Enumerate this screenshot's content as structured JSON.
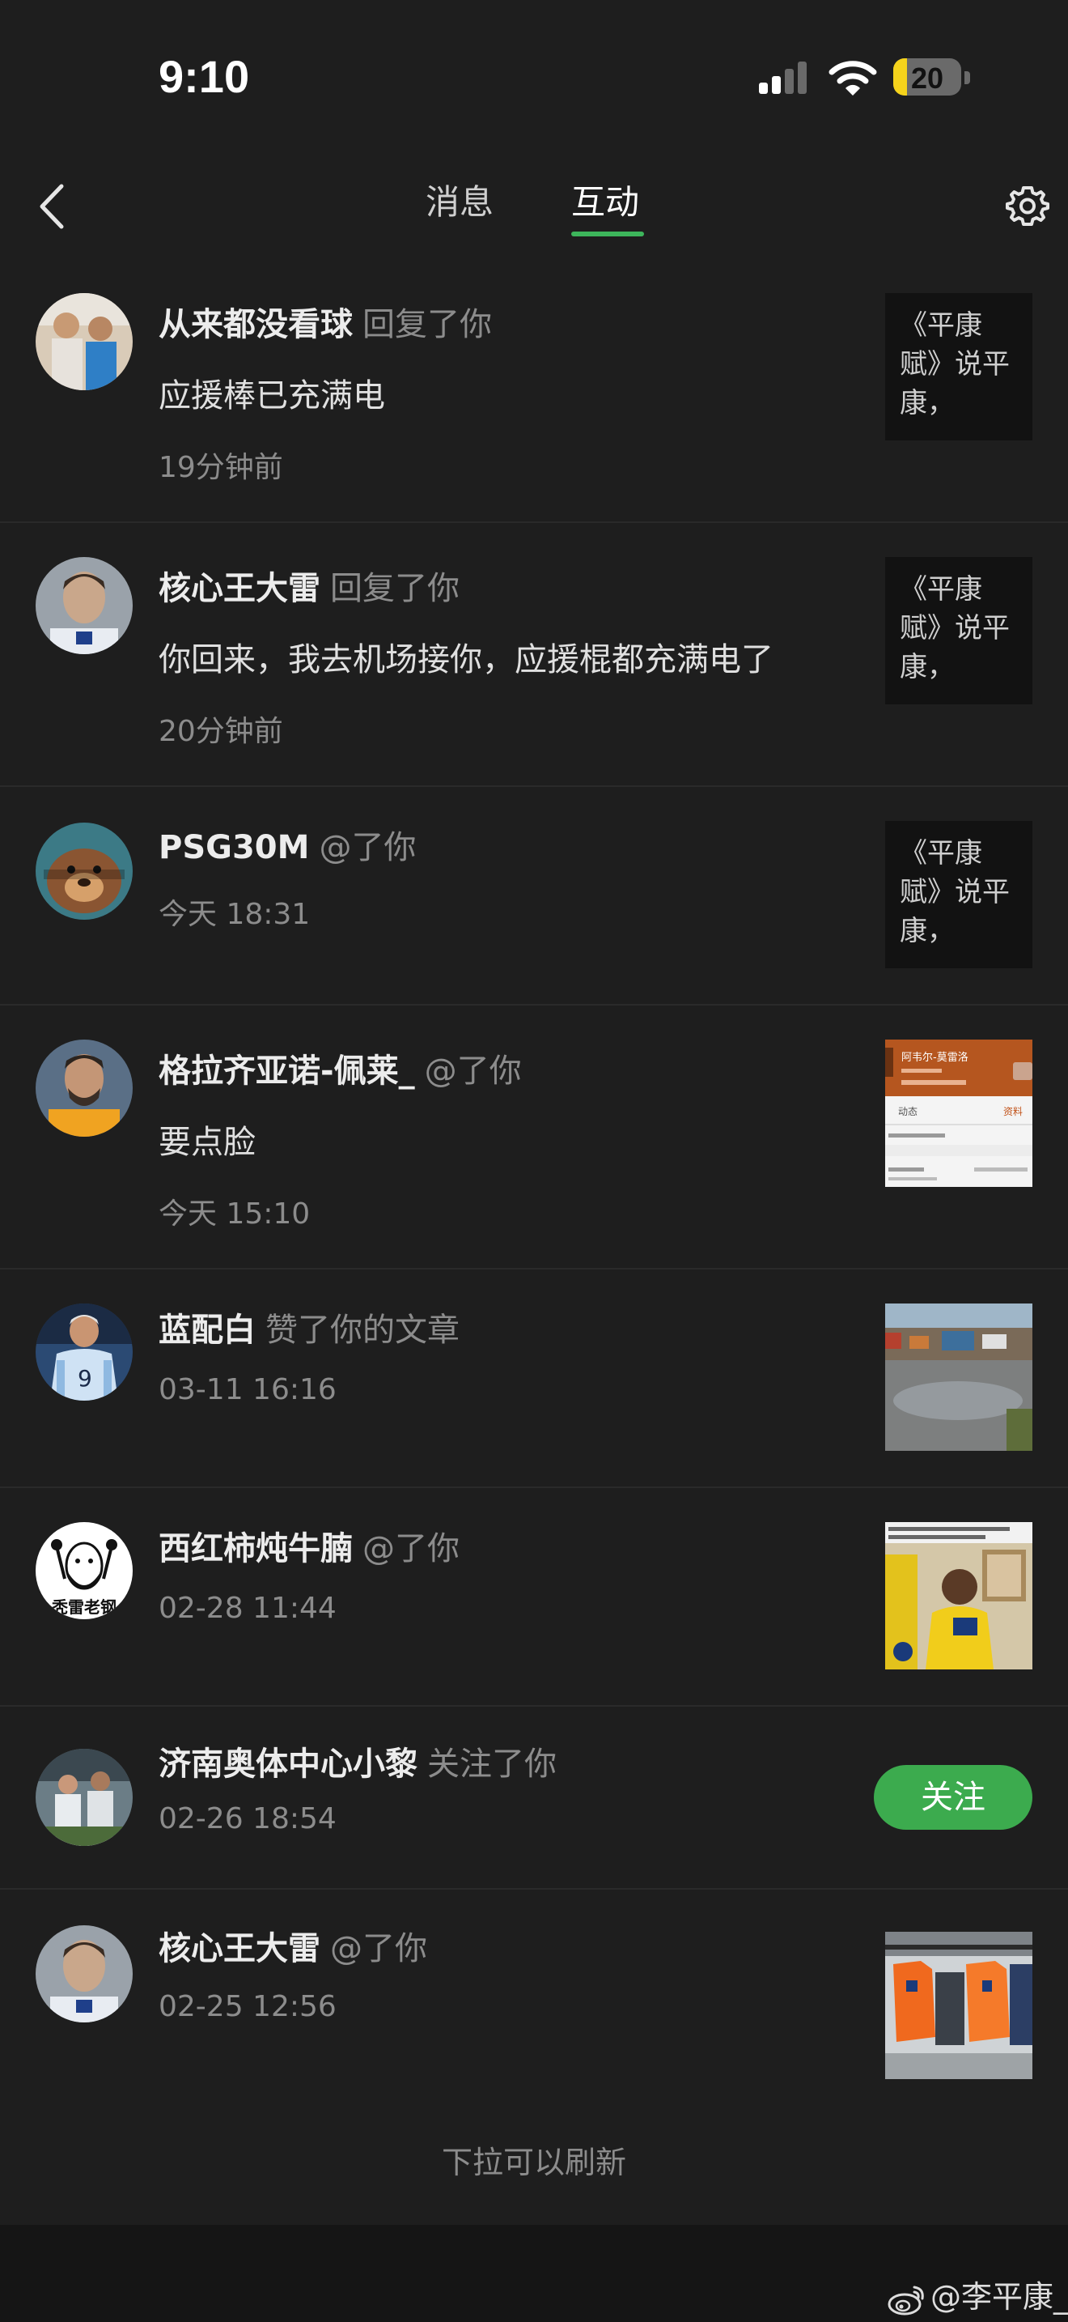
{
  "status_bar": {
    "time": "9:10",
    "battery_level": "20",
    "battery_fraction": 0.2
  },
  "nav": {
    "back_icon": "chevron-left-icon",
    "tabs": [
      {
        "label": "消息"
      },
      {
        "label": "互动"
      }
    ],
    "active_tab": "互动",
    "settings_icon": "gear-icon",
    "accent_color": "#3db55b"
  },
  "items": [
    {
      "name": "从来都没看球",
      "action": "回复了你",
      "content": "应援棒已充满电",
      "time": "19分钟前",
      "thumb_text": "《平康赋》说平康，"
    },
    {
      "name": "核心王大雷",
      "action": "回复了你",
      "content": "你回来，我去机场接你，应援棍都充满电了",
      "time": "20分钟前",
      "thumb_text": "《平康赋》说平康，"
    },
    {
      "name": "PSG30M",
      "action": "@了你",
      "time": "今天 18:31",
      "thumb_text": "《平康赋》说平康，"
    },
    {
      "name": "格拉齐亚诺-佩莱_",
      "action": "@了你",
      "content": "要点脸",
      "time": "今天 15:10",
      "thumb_caption": "阿韦尔-莫雷洛",
      "thumb_tab": "动态",
      "thumb_tab2": "资料"
    },
    {
      "name": "蓝配白",
      "action": "赞了你的文章",
      "time": "03-11 16:16"
    },
    {
      "name": "西红柿炖牛腩",
      "action": "@了你",
      "time": "02-28 11:44",
      "avatar_text": "秃雷老钢"
    },
    {
      "name": "济南奥体中心小黎",
      "action": "关注了你",
      "time": "02-26 18:54",
      "follow_label": "关注"
    },
    {
      "name": "核心王大雷",
      "action": "@了你",
      "time": "02-25 12:56"
    }
  ],
  "footer": {
    "refresh_hint": "下拉可以刷新",
    "watermark": "@李平康_",
    "watermark_icon": "weibo-icon"
  }
}
